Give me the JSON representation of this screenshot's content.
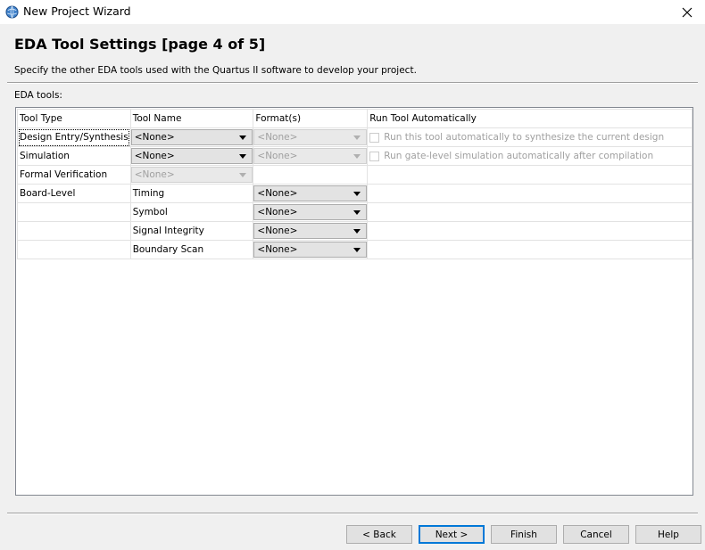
{
  "window": {
    "title": "New Project Wizard",
    "icon": "quartus-globe-icon"
  },
  "header": {
    "title": "EDA Tool Settings [page 4 of 5]",
    "description": "Specify the other EDA tools used with the Quartus II software to develop your project."
  },
  "eda_tools_label": "EDA tools:",
  "table": {
    "columns": [
      "Tool Type",
      "Tool Name",
      "Format(s)",
      "Run Tool Automatically"
    ],
    "rows": [
      {
        "tool_type": "Design Entry/Synthesis",
        "tool_name": "<None>",
        "format": "<None>",
        "format_disabled": true,
        "run_auto": "Run this tool automatically to synthesize the current design",
        "run_auto_checked": false
      },
      {
        "tool_type": "Simulation",
        "tool_name": "<None>",
        "format": "<None>",
        "format_disabled": true,
        "run_auto": "Run gate-level simulation automatically after compilation",
        "run_auto_checked": false
      },
      {
        "tool_type": "Formal Verification",
        "tool_name": "<None>",
        "tool_name_disabled": true
      },
      {
        "tool_type": "Board-Level",
        "tool_name": "Timing",
        "format": "<None>"
      },
      {
        "tool_type": "",
        "tool_name": "Symbol",
        "format": "<None>"
      },
      {
        "tool_type": "",
        "tool_name": "Signal Integrity",
        "format": "<None>"
      },
      {
        "tool_type": "",
        "tool_name": "Boundary Scan",
        "format": "<None>"
      }
    ]
  },
  "buttons": {
    "back": "< Back",
    "next": "Next >",
    "finish": "Finish",
    "cancel": "Cancel",
    "help": "Help"
  }
}
